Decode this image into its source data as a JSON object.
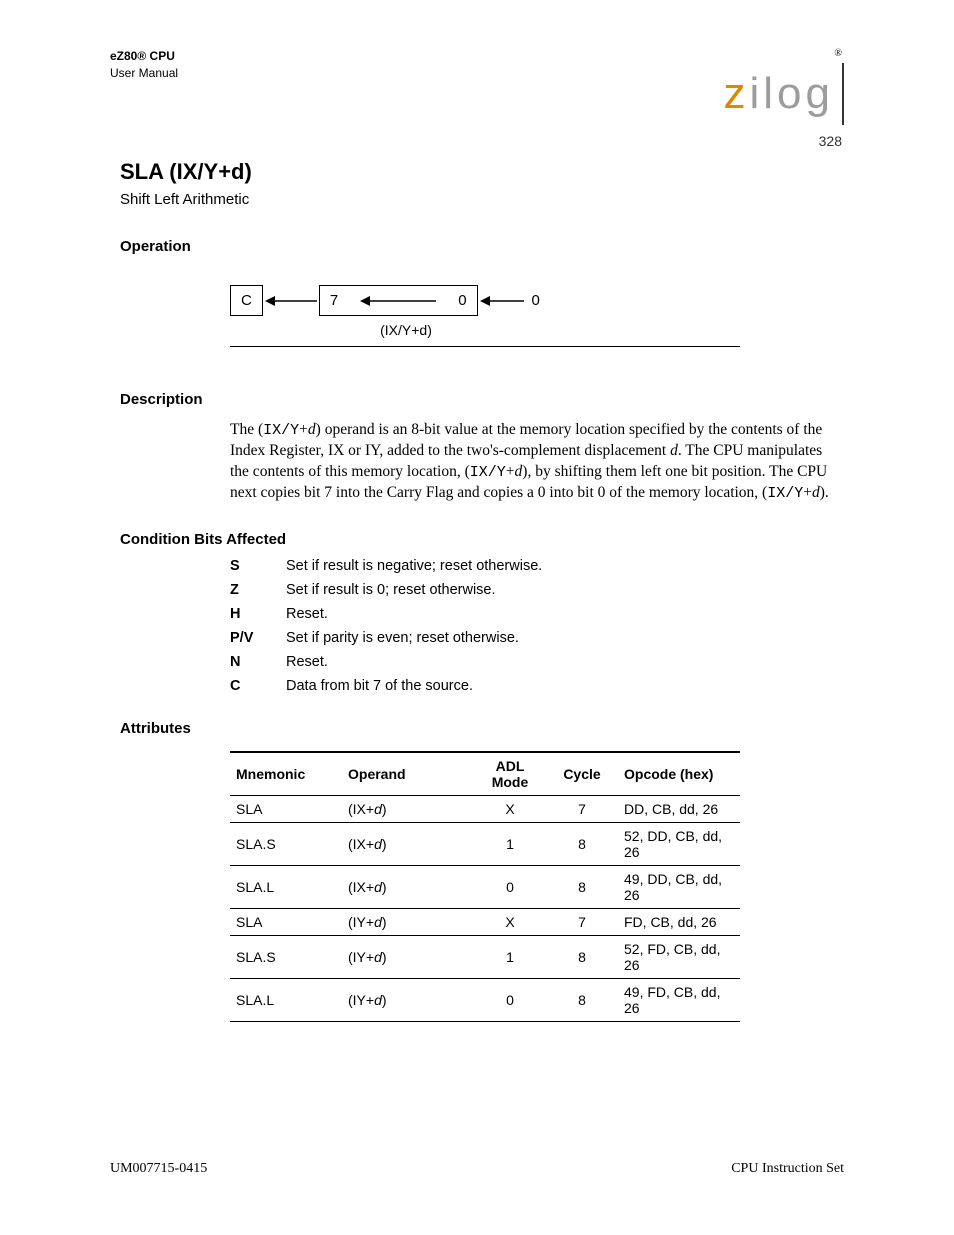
{
  "header": {
    "doc_line1": "eZ80® CPU",
    "doc_line2": "User Manual",
    "registered_mark": "®",
    "logo_text_z": "z",
    "logo_text_rest": "ilog",
    "page_number": "328"
  },
  "instruction": {
    "mnemonic": "SLA (IX/Y+d)",
    "name": "Shift Left Arithmetic"
  },
  "operation": {
    "label": "Operation",
    "c_label": "C",
    "bit_hi": "7",
    "bit_lo": "0",
    "zero_in": "0",
    "reg_caption": "(IX/Y+d)"
  },
  "description": {
    "label": "Description",
    "text": "The (IX/Y+d) operand is an 8-bit value at the memory location specified by the contents of the Index Register, IX or IY, added to the two's-complement displacement d. The CPU manipulates the contents of this memory location, (IX/Y+d), by shifting them left one bit position. The CPU next copies bit 7 into the Carry Flag and copies a 0 into bit 0 of the memory location, (IX/Y+d)."
  },
  "condition_bits": {
    "label": "Condition Bits Affected",
    "rows": [
      {
        "k": "S",
        "v": "Set if result is negative; reset otherwise."
      },
      {
        "k": "Z",
        "v": "Set if result is 0; reset otherwise."
      },
      {
        "k": "H",
        "v": "Reset."
      },
      {
        "k": "P/V",
        "v": "Set if parity is even; reset otherwise."
      },
      {
        "k": "N",
        "v": "Reset."
      },
      {
        "k": "C",
        "v": "Data from bit 7 of the source."
      }
    ]
  },
  "attributes": {
    "label": "Attributes",
    "headers": {
      "mnemonic": "Mnemonic",
      "operand": "Operand",
      "adl": "ADL Mode",
      "cycle": "Cycle",
      "opcode": "Opcode (hex)"
    },
    "rows": [
      {
        "mn": "SLA",
        "op": "(IX+d)",
        "adl": "X",
        "cyc": "7",
        "opc": "DD, CB, dd, 26"
      },
      {
        "mn": "SLA.S",
        "op": "(IX+d)",
        "adl": "1",
        "cyc": "8",
        "opc": "52, DD, CB, dd, 26"
      },
      {
        "mn": "SLA.L",
        "op": "(IX+d)",
        "adl": "0",
        "cyc": "8",
        "opc": "49, DD, CB, dd, 26"
      },
      {
        "mn": "SLA",
        "op": "(IY+d)",
        "adl": "X",
        "cyc": "7",
        "opc": "FD, CB, dd, 26"
      },
      {
        "mn": "SLA.S",
        "op": "(IY+d)",
        "adl": "1",
        "cyc": "8",
        "opc": "52, FD, CB, dd, 26"
      },
      {
        "mn": "SLA.L",
        "op": "(IY+d)",
        "adl": "0",
        "cyc": "8",
        "opc": "49, FD, CB, dd, 26"
      }
    ]
  },
  "footer": {
    "left": "UM007715-0415",
    "right": "CPU Instruction Set"
  }
}
